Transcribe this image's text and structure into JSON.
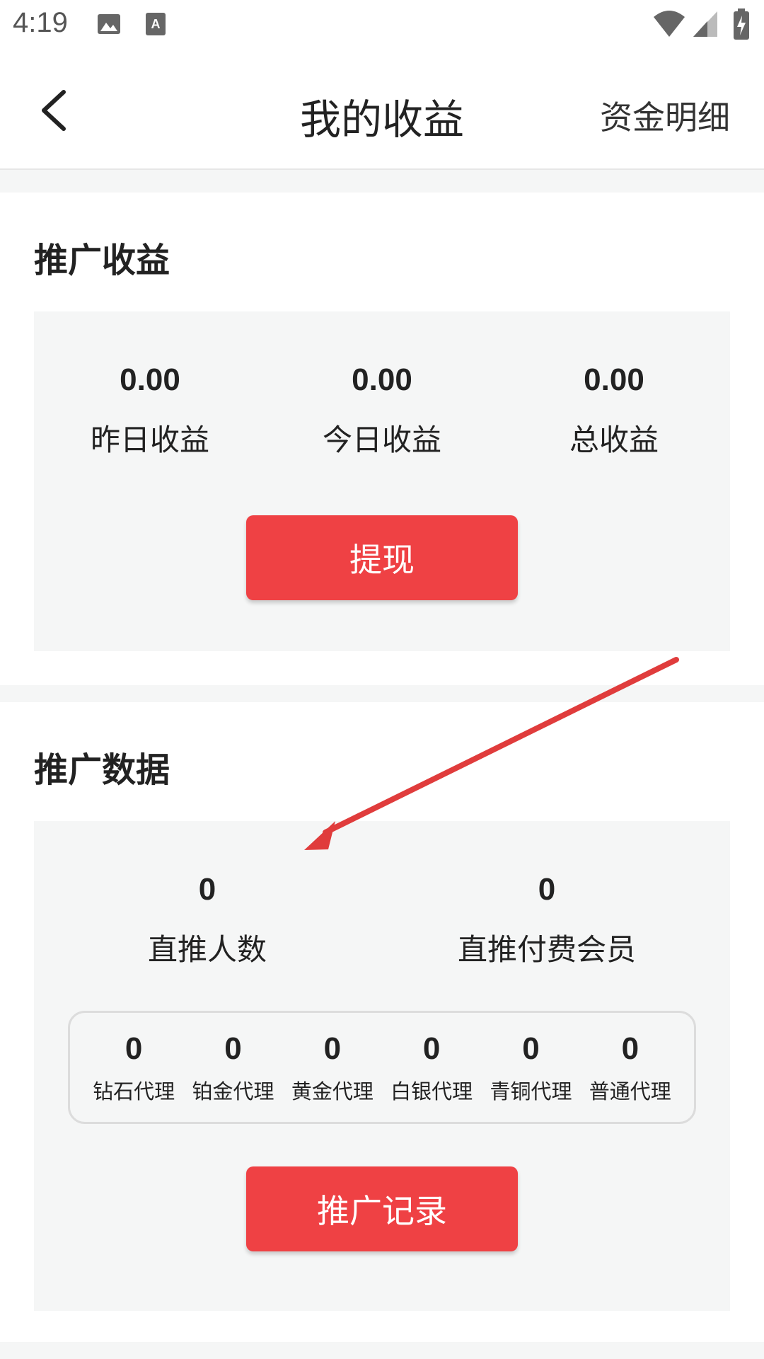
{
  "status_bar": {
    "time": "4:19",
    "icons": [
      "image-icon",
      "keyboard-icon",
      "wifi-icon",
      "signal-icon",
      "battery-icon"
    ]
  },
  "nav": {
    "title": "我的收益",
    "right_action": "资金明细"
  },
  "earnings": {
    "title": "推广收益",
    "stats": [
      {
        "value": "0.00",
        "label": "昨日收益"
      },
      {
        "value": "0.00",
        "label": "今日收益"
      },
      {
        "value": "0.00",
        "label": "总收益"
      }
    ],
    "button": "提现"
  },
  "promo": {
    "title": "推广数据",
    "stats": [
      {
        "value": "0",
        "label": "直推人数"
      },
      {
        "value": "0",
        "label": "直推付费会员"
      }
    ],
    "levels": [
      {
        "value": "0",
        "label": "钻石代理"
      },
      {
        "value": "0",
        "label": "铂金代理"
      },
      {
        "value": "0",
        "label": "黄金代理"
      },
      {
        "value": "0",
        "label": "白银代理"
      },
      {
        "value": "0",
        "label": "青铜代理"
      },
      {
        "value": "0",
        "label": "普通代理"
      }
    ],
    "button": "推广记录"
  },
  "colors": {
    "accent": "#ef4144",
    "annotation_arrow": "#e03c3c"
  }
}
